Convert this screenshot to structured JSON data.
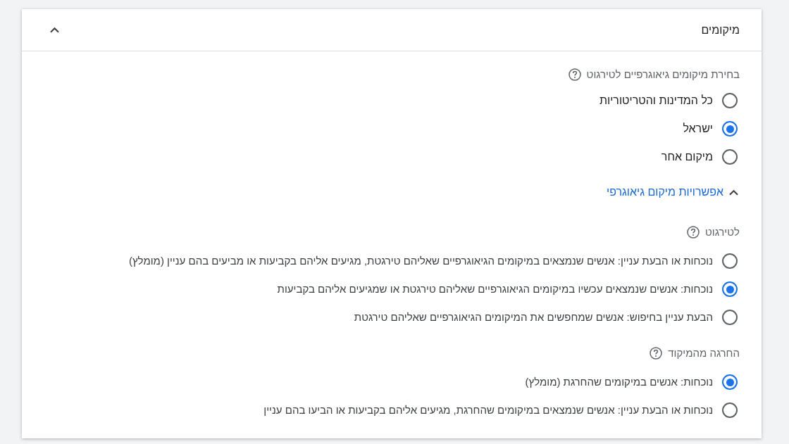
{
  "panel": {
    "title": "מיקומים",
    "expanded": true
  },
  "location_targeting": {
    "label": "בחירת מיקומים גיאוגרפיים לטירגוט",
    "options": [
      {
        "label": "כל המדינות והטריטוריות",
        "selected": false
      },
      {
        "label": "ישראל",
        "selected": true
      },
      {
        "label": "מיקום אחר",
        "selected": false
      }
    ]
  },
  "geo_options": {
    "label": "אפשרויות מיקום גיאוגרפי",
    "expanded": true
  },
  "targeting": {
    "label": "לטירגוט",
    "options": [
      {
        "label": "נוכחות או הבעת עניין: אנשים שנמצאים במיקומים הגיאוגרפיים שאליהם טירגטת, מגיעים אליהם בקביעות או מביעים בהם עניין (מומלץ)",
        "selected": false
      },
      {
        "label": "נוכחות: אנשים שנמצאים עכשיו במיקומים הגיאוגרפיים שאליהם טירגטת או שמגיעים אליהם בקביעות",
        "selected": true
      },
      {
        "label": "הבעת עניין בחיפוש: אנשים שמחפשים את המיקומים הגיאוגרפיים שאליהם טירגטת",
        "selected": false
      }
    ]
  },
  "exclusion": {
    "label": "החרגה מהמיקוד",
    "options": [
      {
        "label": "נוכחות: אנשים במיקומים שהחרגת (מומלץ)",
        "selected": true
      },
      {
        "label": "נוכחות או הבעת עניין: אנשים שנמצאים במיקומים שהחרגת, מגיעים אליהם בקביעות או הביעו בהם עניין",
        "selected": false
      }
    ]
  }
}
